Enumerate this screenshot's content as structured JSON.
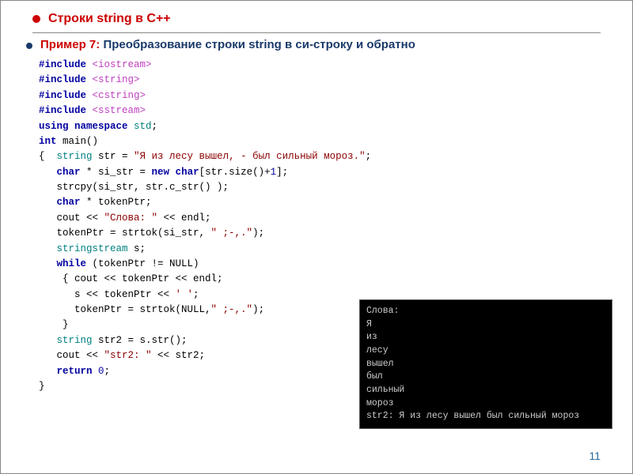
{
  "title": "Строки  string в С++",
  "subtitle_prefix": "Пример 7: ",
  "subtitle_rest": "Преобразование строки string в си-строку и обратно",
  "code": {
    "l1a": "#include ",
    "l1b": "<iostream>",
    "l2a": "#include ",
    "l2b": "<string>",
    "l3a": "#include ",
    "l3b": "<cstring>",
    "l4a": "#include ",
    "l4b": "<sstream>",
    "l5a": "using namespace ",
    "l5b": "std",
    "l5c": ";",
    "l6a": "int ",
    "l6b": "main",
    "l6c": "()",
    "l7a": "{  ",
    "l7b": "string ",
    "l7c": "str = ",
    "l7d": "\"Я из лесу вышел, - был сильный мороз.\"",
    "l7e": ";",
    "l8a": "   ",
    "l8b": "char ",
    "l8c": "* si_str = ",
    "l8d": "new ",
    "l8e": "char",
    "l8f": "[str.size()+",
    "l8g": "1",
    "l8h": "];",
    "l9a": "   strcpy(si_str, str.c_str() );",
    "l10a": "   ",
    "l10b": "char ",
    "l10c": "* tokenPtr;",
    "l11a": "   cout << ",
    "l11b": "\"Слова: \"",
    "l11c": " << endl;",
    "l12a": "   tokenPtr = strtok(si_str, ",
    "l12b": "\" ;-,.\"",
    "l12c": ");",
    "l13a": "   ",
    "l13b": "stringstream ",
    "l13c": "s;",
    "l14a": "   ",
    "l14b": "while ",
    "l14c": "(tokenPtr != NULL)",
    "l15a": "    { cout << tokenPtr << endl;",
    "l16a": "      s << tokenPtr << ",
    "l16b": "' '",
    "l16c": ";",
    "l17a": "      tokenPtr = strtok(NULL,",
    "l17b": "\" ;-,.\"",
    "l17c": ");",
    "l18a": "    }",
    "l19a": "   ",
    "l19b": "string ",
    "l19c": "str2 = s.str();",
    "l20a": "   cout << ",
    "l20b": "\"str2: \"",
    "l20c": " << str2;",
    "l21a": "   ",
    "l21b": "return ",
    "l21c": "0",
    "l21d": ";",
    "l22a": "}"
  },
  "output": "Слова:\nЯ\nиз\nлесу\nвышел\nбыл\nсильный\nмороз\nstr2: Я из лесу вышел был сильный мороз",
  "page_number": "11"
}
